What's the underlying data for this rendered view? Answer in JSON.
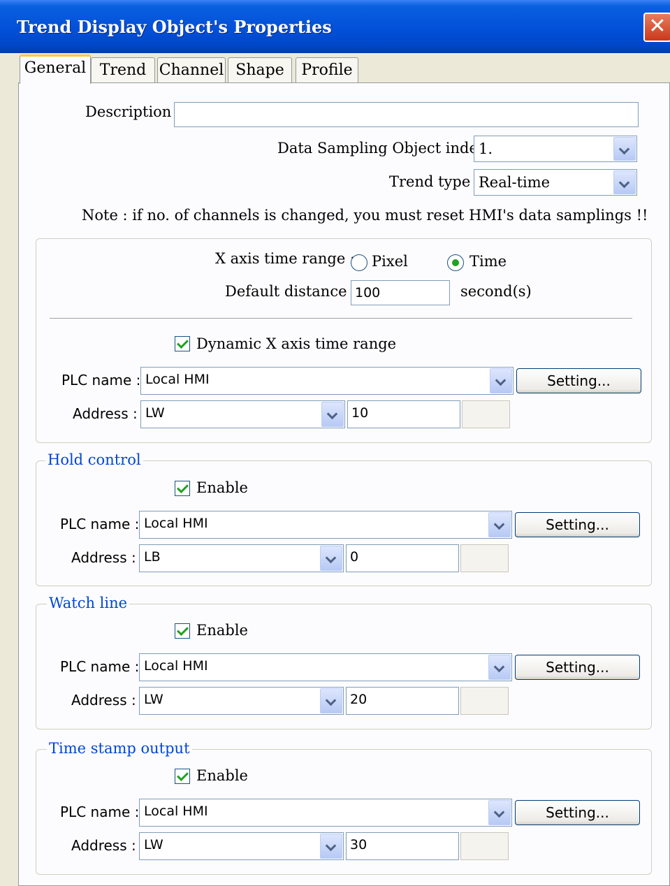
{
  "window": {
    "title": "Trend Display Object's Properties",
    "close_label": "✕"
  },
  "tabs": [
    "General",
    "Trend",
    "Channel",
    "Shape",
    "Profile"
  ],
  "general": {
    "description_label": "Description :",
    "description_value": "",
    "sampling_index_label": "Data Sampling Object index :",
    "sampling_index_value": "1.",
    "trend_type_label": "Trend type :",
    "trend_type_value": "Real-time",
    "note": "Note : if no. of channels is changed, you must reset HMI's  data samplings !!"
  },
  "x_axis": {
    "range_label": "X axis time range :",
    "option_pixel": "Pixel",
    "option_time": "Time",
    "selected": "Time",
    "distance_label": "Default distance :",
    "distance_value": "100",
    "distance_unit": "second(s)",
    "dynamic_label": "Dynamic X axis time range",
    "dynamic_checked": true,
    "plc_label": "PLC name :",
    "plc_value": "Local HMI",
    "setting_label": "Setting...",
    "address_label": "Address :",
    "address_device": "LW",
    "address_value": "10"
  },
  "hold_control": {
    "legend": "Hold control",
    "enable_label": "Enable",
    "enabled": true,
    "plc_label": "PLC name :",
    "plc_value": "Local HMI",
    "setting_label": "Setting...",
    "address_label": "Address :",
    "address_device": "LB",
    "address_value": "0"
  },
  "watch_line": {
    "legend": "Watch line",
    "enable_label": "Enable",
    "enabled": true,
    "plc_label": "PLC name :",
    "plc_value": "Local HMI",
    "setting_label": "Setting...",
    "address_label": "Address :",
    "address_device": "LW",
    "address_value": "20"
  },
  "time_stamp": {
    "legend": "Time stamp output",
    "enable_label": "Enable",
    "enabled": true,
    "plc_label": "PLC name :",
    "plc_value": "Local HMI",
    "setting_label": "Setting...",
    "address_label": "Address :",
    "address_device": "LW",
    "address_value": "30"
  },
  "colors": {
    "title_bar": "#0250D8",
    "legend_text": "#0046D5",
    "check_mark": "#21A121",
    "dialog_bg": "#ECE9D8"
  }
}
